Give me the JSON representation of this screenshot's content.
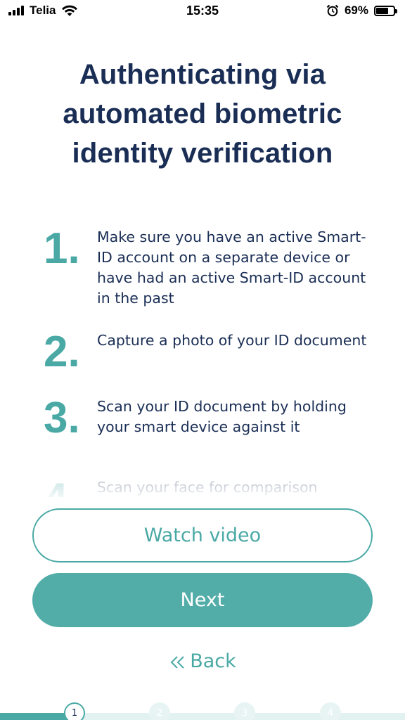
{
  "status_bar": {
    "carrier": "Telia",
    "time": "15:35",
    "battery_percent": "69%",
    "battery_level": 0.69,
    "icons": [
      "signal-icon",
      "wifi-icon",
      "alarm-icon",
      "battery-icon"
    ]
  },
  "title": "Authenticating via automated biometric identity verification",
  "steps": [
    {
      "number": "1.",
      "text": "Make sure you have an active Smart-ID account on a separate device or have had an active Smart-ID account in the past"
    },
    {
      "number": "2.",
      "text": "Capture a photo of your ID document"
    },
    {
      "number": "3.",
      "text": "Scan your ID document by holding your smart device against it"
    },
    {
      "number": "4.",
      "text": "Scan your face for comparison"
    }
  ],
  "buttons": {
    "watch_video": "Watch video",
    "next": "Next",
    "back": "Back"
  },
  "progress": {
    "steps": [
      "1",
      "2",
      "3",
      "4"
    ],
    "current": 1
  },
  "colors": {
    "accent": "#4aa9a5",
    "title": "#1a2e55",
    "button_fill": "#52aca8"
  }
}
